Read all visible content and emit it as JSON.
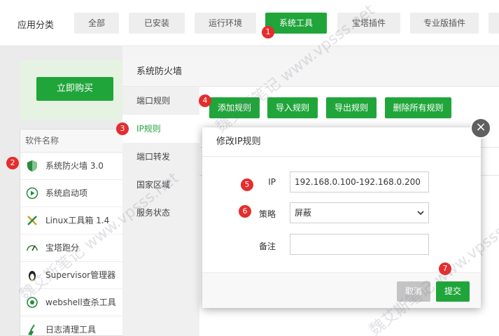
{
  "topbar": {
    "label": "应用分类",
    "categories": [
      "全部",
      "已安装",
      "运行环境",
      "系统工具",
      "宝塔插件",
      "专业版插件"
    ]
  },
  "left": {
    "buy_label": "立即购买",
    "list_header": "软件名称",
    "items": [
      "系统防火墙 3.0",
      "系统启动项",
      "Linux工具箱 1.4",
      "宝塔跑分",
      "Supervisor管理器",
      "webshell查杀工具",
      "日志清理工具"
    ]
  },
  "firewall": {
    "title": "系统防火墙",
    "nav": [
      "端口规则",
      "IP规则",
      "端口转发",
      "国家区域",
      "服务状态"
    ],
    "buttons": [
      "添加规则",
      "导入规则",
      "导出规则",
      "删除所有规则"
    ]
  },
  "modal": {
    "title": "修改IP规则",
    "ip_label": "IP",
    "ip_value": "192.168.0.100-192.168.0.200",
    "policy_label": "策略",
    "policy_value": "屏蔽",
    "remark_label": "备注",
    "remark_value": "",
    "cancel_label": "取消",
    "submit_label": "提交"
  },
  "badges": [
    "1",
    "2",
    "3",
    "4",
    "5",
    "6",
    "7"
  ],
  "watermark": "魏艾斯笔记 www.vpsss.net",
  "colors": {
    "accent": "#20a53a",
    "badge": "#e52d2d"
  }
}
